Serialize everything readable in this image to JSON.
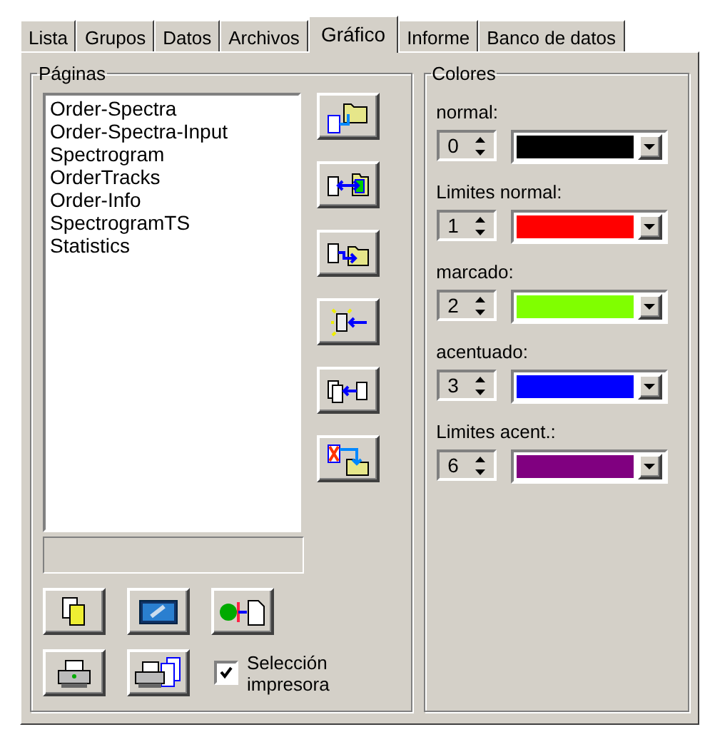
{
  "tabs": [
    {
      "label": "Lista",
      "selected": false
    },
    {
      "label": "Grupos",
      "selected": false
    },
    {
      "label": "Datos",
      "selected": false
    },
    {
      "label": "Archivos",
      "selected": false
    },
    {
      "label": "Gráfico",
      "selected": true
    },
    {
      "label": "Informe",
      "selected": false
    },
    {
      "label": "Banco de datos",
      "selected": false
    }
  ],
  "pages": {
    "title": "Páginas",
    "items": [
      "Order-Spectra",
      "Order-Spectra-Input",
      "Spectrogram",
      "OrderTracks",
      "Order-Info",
      "SpectrogramTS",
      "Statistics"
    ],
    "printer_selection": {
      "label": "Selección impresora",
      "checked": true
    }
  },
  "colors": {
    "title": "Colores",
    "items": [
      {
        "label": "normal:",
        "index": "0",
        "color": "#000000"
      },
      {
        "label": "Limites normal:",
        "index": "1",
        "color": "#ff0000"
      },
      {
        "label": "marcado:",
        "index": "2",
        "color": "#80ff00"
      },
      {
        "label": "acentuado:",
        "index": "3",
        "color": "#0000ff"
      },
      {
        "label": "Limites acent.:",
        "index": "6",
        "color": "#800080"
      }
    ]
  }
}
